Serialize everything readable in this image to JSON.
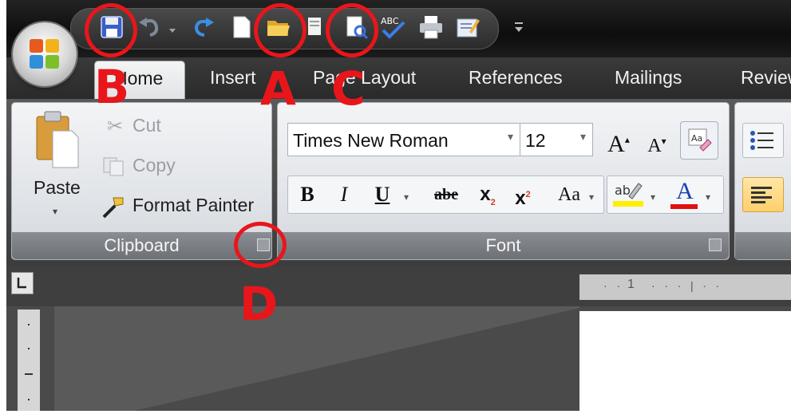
{
  "tabs": [
    "Home",
    "Insert",
    "Page Layout",
    "References",
    "Mailings",
    "Review"
  ],
  "clipboard": {
    "paste_label": "Paste",
    "cut_label": "Cut",
    "copy_label": "Copy",
    "format_painter_label": "Format Painter",
    "group_label": "Clipboard"
  },
  "font": {
    "font_name": "Times New Roman",
    "font_size": "12",
    "group_label": "Font",
    "grow_label": "A",
    "shrink_label": "A",
    "bold": "B",
    "italic": "I",
    "underline": "U",
    "strike": "abe",
    "subscript": "x",
    "superscript": "x",
    "change_case": "Aa",
    "font_color": "A"
  },
  "annotations": {
    "a": "A",
    "b": "B",
    "c": "C",
    "d": "D"
  },
  "ruler": {
    "mark": "1"
  },
  "icons": {
    "save": "save-icon",
    "undo": "undo-icon",
    "redo": "redo-icon",
    "new": "new-document-icon",
    "open": "open-folder-icon",
    "print_preview": "print-preview-icon",
    "spelling": "spelling-check-icon",
    "print": "print-icon",
    "customize": "customize-qat-icon"
  },
  "colors": {
    "annotation_red": "#e8161b",
    "highlight_yellow": "#ffee00",
    "font_color_red": "#e01010"
  }
}
